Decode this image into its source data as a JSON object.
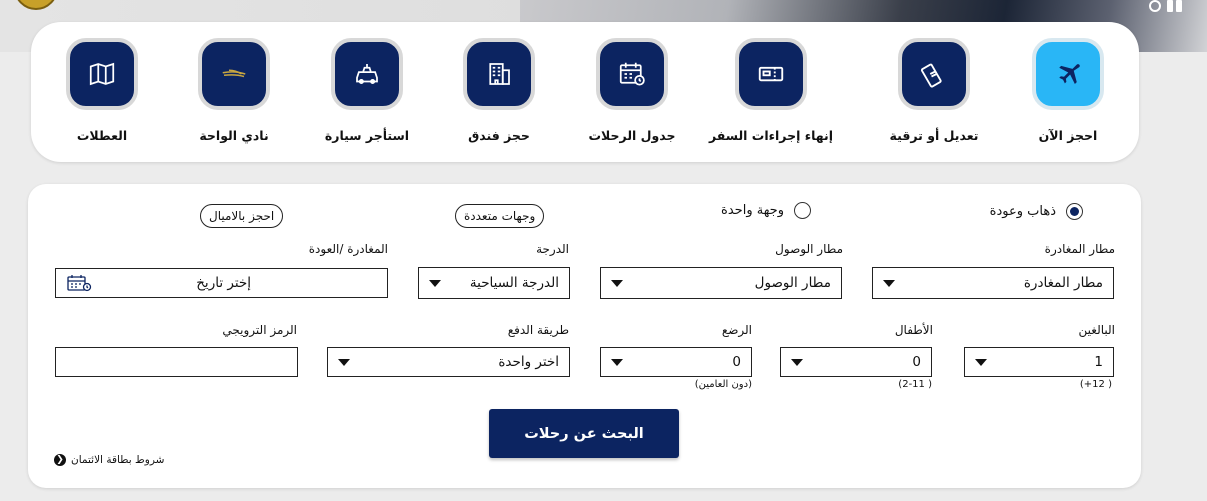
{
  "quick_actions": [
    {
      "label": "احجز الآن",
      "icon": "airplane-icon",
      "active": true
    },
    {
      "label": "تعديل أو ترقية",
      "icon": "ticket-icon",
      "active": false
    },
    {
      "label": "إنهاء إجراءات السفر",
      "icon": "boarding-pass-icon",
      "active": false
    },
    {
      "label": "جدول الرحلات",
      "icon": "calendar-clock-icon",
      "active": false
    },
    {
      "label": "حجز فندق",
      "icon": "hotel-icon",
      "active": false
    },
    {
      "label": "استأجر سيارة",
      "icon": "car-icon",
      "active": false
    },
    {
      "label": "نادي الواحة",
      "icon": "oasis-logo-icon",
      "active": false
    },
    {
      "label": "العطلات",
      "icon": "map-icon",
      "active": false
    }
  ],
  "trip_type": {
    "round_trip": "ذهاب وعودة",
    "one_way": "وجهة واحدة",
    "multi_city": "وجهات متعددة",
    "book_with_miles": "احجز بالاميال",
    "selected": "round_trip"
  },
  "fields": {
    "origin": {
      "label": "مطار المغادرة",
      "value": "مطار المغادرة"
    },
    "destination": {
      "label": "مطار الوصول",
      "value": "مطار الوصول"
    },
    "cabin": {
      "label": "الدرجة",
      "value": "الدرجة السياحية"
    },
    "dates": {
      "label": "المغادرة /العودة",
      "value": "إختر تاريخ"
    },
    "adults": {
      "label": "البالغين",
      "value": "1",
      "note": "( 12+)"
    },
    "children": {
      "label": "الأطفال",
      "value": "0",
      "note": "( 2-11)"
    },
    "infants": {
      "label": "الرضع",
      "value": "0",
      "note": "(دون العامين)"
    },
    "payment": {
      "label": "طريقة الدفع",
      "value": "اختر واحدة"
    },
    "promo": {
      "label": "الرمز الترويجي",
      "value": ""
    }
  },
  "search_button": "البحث عن رحلات",
  "terms_link": "شروط بطاقة الائتمان",
  "colors": {
    "navy": "#0c2461",
    "active_icon": "#29b6f6"
  }
}
